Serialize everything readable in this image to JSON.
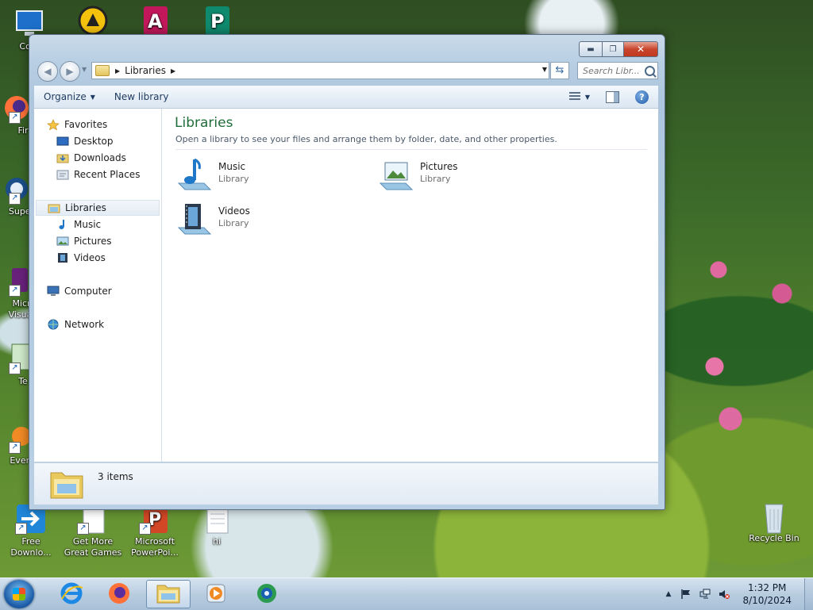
{
  "desktop": {
    "icons": [
      {
        "label": "Com"
      },
      {
        "label": "Fir"
      },
      {
        "label": "Super"
      },
      {
        "label": "Micr Visual"
      },
      {
        "label": "Te"
      },
      {
        "label": "Every"
      },
      {
        "label": "Free Downlo..."
      },
      {
        "label": "Get More Great Games"
      },
      {
        "label": "Microsoft PowerPoi..."
      },
      {
        "label": "hi"
      },
      {
        "label": "Recycle Bin"
      }
    ]
  },
  "window": {
    "address_path": "Libraries",
    "search_placeholder": "Search Libr...",
    "toolbar": {
      "organize": "Organize",
      "new_library": "New library"
    },
    "nav_pane": {
      "favorites": "Favorites",
      "desktop": "Desktop",
      "downloads": "Downloads",
      "recent_places": "Recent Places",
      "libraries": "Libraries",
      "music": "Music",
      "pictures": "Pictures",
      "videos": "Videos",
      "computer": "Computer",
      "network": "Network"
    },
    "main": {
      "title": "Libraries",
      "subtitle": "Open a library to see your files and arrange them by folder, date, and other properties.",
      "items": [
        {
          "name": "Music",
          "type": "Library"
        },
        {
          "name": "Pictures",
          "type": "Library"
        },
        {
          "name": "Videos",
          "type": "Library"
        }
      ]
    },
    "details": {
      "count": "3 items"
    }
  },
  "taskbar": {
    "clock_time": "1:32 PM",
    "clock_date": "8/10/2024"
  },
  "colors": {
    "library_title": "#1f6e3a",
    "close_button": "#c8452c",
    "taskbar": "#b9cde0"
  }
}
